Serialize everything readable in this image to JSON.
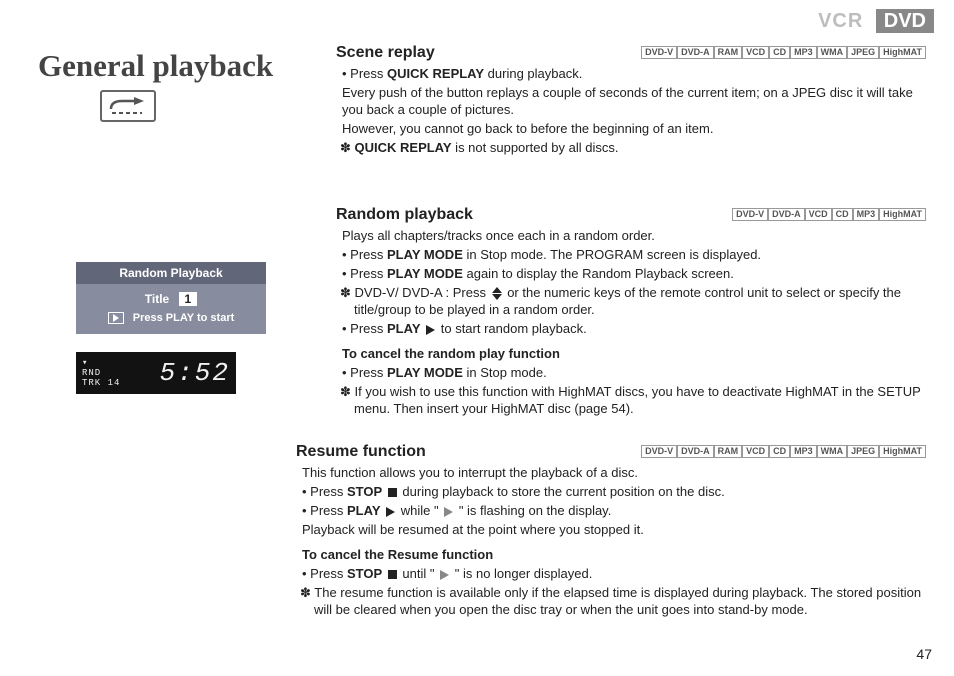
{
  "header": {
    "vcr": "VCR",
    "dvd": "DVD"
  },
  "title": "General playback",
  "panel": {
    "heading": "Random Playback",
    "title_label": "Title",
    "title_number": "1",
    "instruction": "Press PLAY to start"
  },
  "lcd": {
    "lines": "RND\nTRK",
    "trk": "14",
    "time": "5:52"
  },
  "sections": {
    "scene": {
      "heading": "Scene replay",
      "tags": [
        "DVD-V",
        "DVD-A",
        "RAM",
        "VCD",
        "CD",
        "MP3",
        "WMA",
        "JPEG",
        "HighMAT"
      ],
      "b1_pre": "Press ",
      "b1_bold": "QUICK REPLAY",
      "b1_post": " during playback.",
      "p1": "Every push of the button replays a couple of seconds of the current item; on a JPEG disc it will take you back a couple of pictures.",
      "p2": "However, you cannot go back to before the beginning of an item.",
      "s1_bold": "QUICK REPLAY",
      "s1_post": " is not supported by all discs."
    },
    "random": {
      "heading": "Random playback",
      "tags": [
        "DVD-V",
        "DVD-A",
        "VCD",
        "CD",
        "MP3",
        "HighMAT"
      ],
      "intro": "Plays all chapters/tracks once each in a random order.",
      "b1_pre": "Press ",
      "b1_bold": "PLAY MODE",
      "b1_post": " in Stop mode. The PROGRAM screen is displayed.",
      "b2_pre": "Press ",
      "b2_bold": "PLAY MODE",
      "b2_post": " again to display the Random Playback screen.",
      "s1_pre": "DVD-V/ DVD-A : Press ",
      "s1_post": " or the numeric keys of the remote control unit to select or specify the title/group to be played in a random order.",
      "b3_pre": "Press ",
      "b3_bold": "PLAY",
      "b3_post": " to start random playback.",
      "cancel_h": "To cancel the random play function",
      "c1_pre": "Press ",
      "c1_bold": "PLAY MODE",
      "c1_post": " in Stop mode.",
      "s2": "If you wish to use this function with HighMAT discs, you have to deactivate HighMAT in the SETUP menu. Then insert your HighMAT disc (page 54)."
    },
    "resume": {
      "heading": "Resume function",
      "tags": [
        "DVD-V",
        "DVD-A",
        "RAM",
        "VCD",
        "CD",
        "MP3",
        "WMA",
        "JPEG",
        "HighMAT"
      ],
      "intro": "This function allows you to interrupt the playback of a disc.",
      "b1_pre": "Press ",
      "b1_bold": "STOP",
      "b1_post": " during playback to store the current position on the disc.",
      "b2_pre": "Press ",
      "b2_bold": "PLAY",
      "b2_mid": " while \" ",
      "b2_post": " \" is flashing on the display.",
      "p1": "Playback will be resumed at the point where you stopped it.",
      "cancel_h": "To cancel the Resume function",
      "c1_pre": "Press ",
      "c1_bold": "STOP",
      "c1_mid": " until \" ",
      "c1_post": " \" is no longer displayed.",
      "s1": "The resume function is available only if the elapsed time is displayed during playback. The stored position will be cleared when you open the disc tray or when the unit goes into stand-by mode."
    }
  },
  "page_number": "47"
}
